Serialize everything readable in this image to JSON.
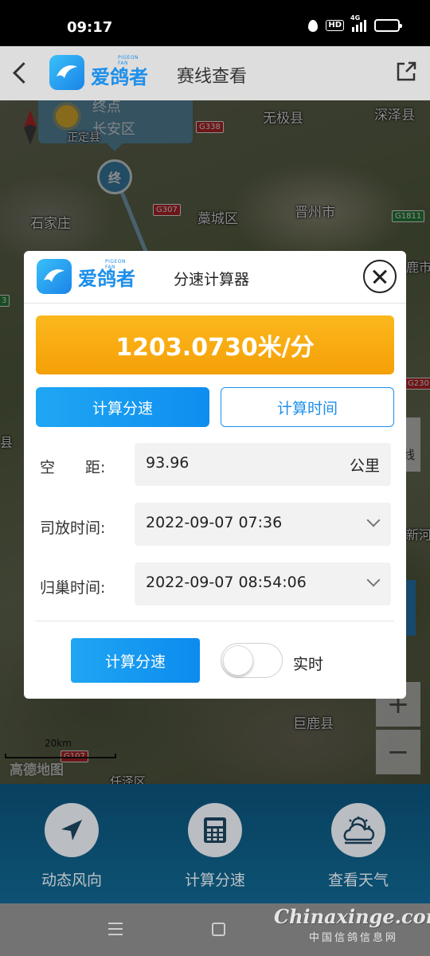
{
  "status_bar": {
    "time": "09:17",
    "hd": "HD",
    "network": "4G"
  },
  "header": {
    "brand": "爱鸽者",
    "brand_sub": "PIGEON FAN",
    "title": "赛线查看"
  },
  "map": {
    "finish": {
      "line1": "终点",
      "line2": "长安区",
      "marker": "终"
    },
    "labels": [
      "无极县",
      "深泽县",
      "石家庄",
      "藁城区",
      "晋州市",
      "巨鹿县",
      "正定县",
      "任泽区",
      "县",
      "线",
      "鹿市",
      "新河"
    ],
    "roads": [
      "G338",
      "G307",
      "G1811",
      "G230",
      "G107",
      "3"
    ],
    "scale": "20km",
    "provider": "高德地图",
    "zoom_in": "+",
    "zoom_out": "−"
  },
  "dialog": {
    "brand": "爱鸽者",
    "brand_sub": "PIGEON FAN",
    "title": "分速计算器",
    "result": "1203.0730米/分",
    "tabs": [
      "计算分速",
      "计算时间"
    ],
    "distance": {
      "label": "空　　距:",
      "value": "93.96",
      "unit": "公里"
    },
    "release": {
      "label": "司放时间:",
      "value": "2022-09-07 07:36"
    },
    "arrival": {
      "label": "归巢时间:",
      "value": "2022-09-07 08:54:06"
    },
    "calc_button": "计算分速",
    "realtime_label": "实时",
    "realtime_on": false
  },
  "bottom_nav": [
    {
      "label": "动态风向",
      "icon": "navigation-arrow-icon"
    },
    {
      "label": "计算分速",
      "icon": "calculator-icon"
    },
    {
      "label": "查看天气",
      "icon": "weather-icon"
    }
  ],
  "watermark": {
    "main": "Chinaxinge.com",
    "sub": "中国信鸽信息网"
  },
  "colors": {
    "accent": "#1d8fea",
    "result_orange": "#f8ab12",
    "bottom_bar": "#0f5d84"
  }
}
